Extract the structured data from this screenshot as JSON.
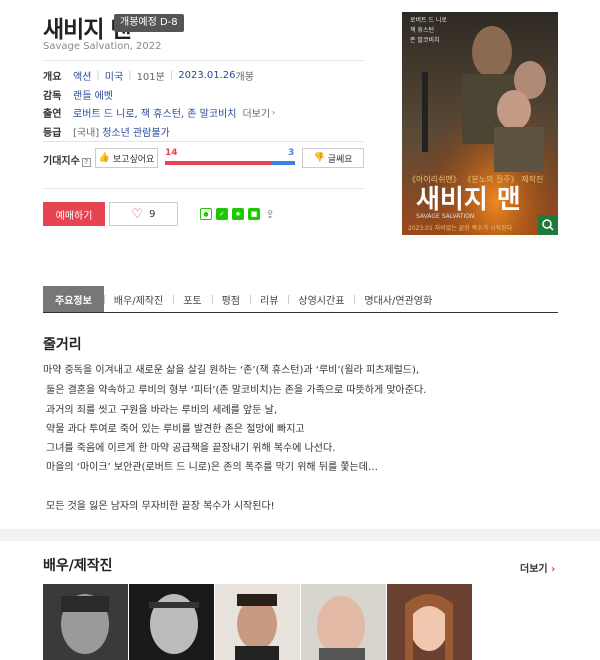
{
  "movie": {
    "title_ko": "새비지 맨",
    "badge": "개봉예정  D-8",
    "original_title": "Savage Salvation, 2022"
  },
  "info": {
    "overview_label": "개요",
    "genre": "액션",
    "country": "미국",
    "runtime": "101분",
    "release": "2023.01.26",
    "release_suffix": "개봉",
    "director_label": "감독",
    "director": "랜들 에벳",
    "cast_label": "출연",
    "cast": "로버트 드 니로, 잭 휴스턴, 존 말코비치",
    "cast_more": "더보기",
    "rating_label": "등급",
    "rating_prefix": "[국내]",
    "rating": "청소년 관람불가"
  },
  "expectation": {
    "label": "기대지수",
    "want_label": "보고싶어요",
    "want_count": "14",
    "nah_count": "3",
    "nah_label": "글쎄요",
    "want_ratio": 0.82
  },
  "actions": {
    "book_label": "예매하기",
    "like_count": "9"
  },
  "tabs": [
    "주요정보",
    "배우/제작진",
    "포토",
    "평점",
    "리뷰",
    "상영시간표",
    "명대사/연관영화"
  ],
  "synopsis": {
    "title": "줄거리",
    "lines": [
      "마약 중독을 이겨내고 새로운 삶을 살길 원하는 ‘존’(잭 휴스턴)과 ‘루비’(윌라 피츠제럴드),",
      "둘은 결혼을 약속하고 루비의 형부 ‘피터’(존 말코비치)는 존을 가족으로 따뜻하게 맞아준다.",
      "과거의 죄를 씻고 구원을 바라는 루비의 세례를 앞둔 날,",
      "약물 과다 투여로 죽어 있는 루비를 발견한 존은 절망에 빠지고",
      "그녀를 죽음에 이르게 한 마약 공급책을 끝장내기 위해 복수에 나선다.",
      "마을의 ‘마이크’ 보안관(로버트 드 니로)은 존의 폭주를 막기 위해 뒤를 쫓는데…",
      "모든 것을 잃은 남자의 무자비한 끝장 복수가 시작된다!"
    ]
  },
  "cast_section": {
    "title": "배우/제작진",
    "more": "더보기"
  },
  "colors": {
    "accent_red": "#e64451",
    "accent_blue": "#3b82e6",
    "link": "#2a4a9a"
  }
}
